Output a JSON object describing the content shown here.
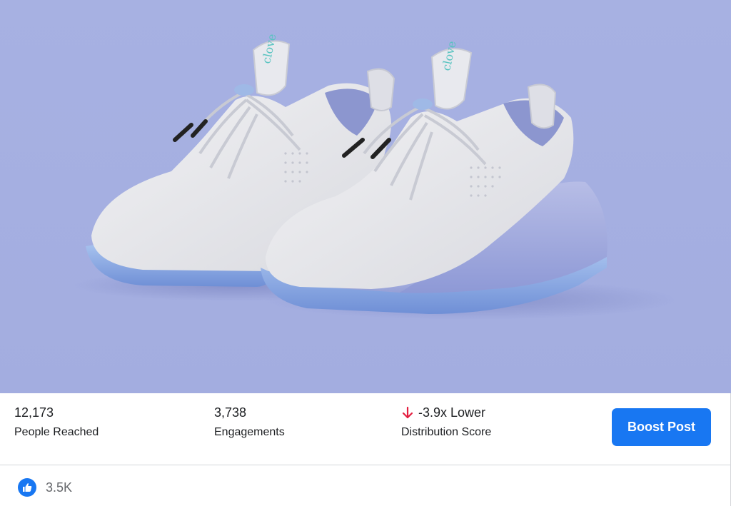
{
  "stats": {
    "people_reached": {
      "value": "12,173",
      "label": "People Reached"
    },
    "engagements": {
      "value": "3,738",
      "label": "Engagements"
    },
    "distribution": {
      "value": "-3.9x Lower",
      "label": "Distribution Score",
      "trend_icon": "arrow-down-icon",
      "trend_color": "#e41e3f"
    }
  },
  "actions": {
    "boost_label": "Boost Post"
  },
  "reactions": {
    "icon": "like-icon",
    "count": "3.5K"
  },
  "media": {
    "logo_text": "clove",
    "background_color": "#a6b0e0"
  },
  "colors": {
    "accent": "#1877f2",
    "text": "#1c1e21",
    "muted": "#65676b"
  }
}
